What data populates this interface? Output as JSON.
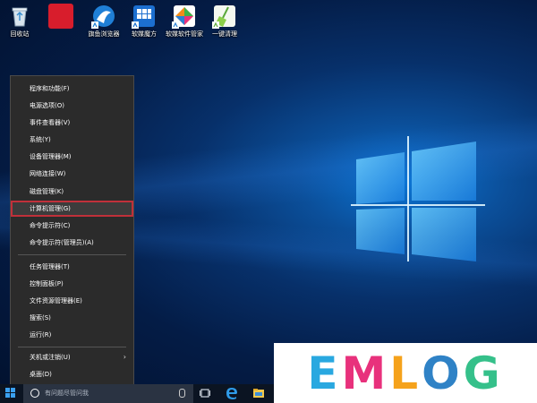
{
  "desktop": {
    "icons": [
      {
        "label": "回收站",
        "icon": "recycle-bin-icon"
      },
      {
        "label": "",
        "icon": "red-app-icon"
      },
      {
        "label": "旗鱼浏览器",
        "icon": "browser-icon"
      },
      {
        "label": "软媒魔方",
        "icon": "rubik-cube-icon"
      },
      {
        "label": "软媒软件管家",
        "icon": "software-manager-icon"
      },
      {
        "label": "一键清理",
        "icon": "broom-cleaner-icon"
      }
    ]
  },
  "context_menu": {
    "items": [
      {
        "label": "程序和功能(F)"
      },
      {
        "label": "电源选项(O)"
      },
      {
        "label": "事件查看器(V)"
      },
      {
        "label": "系统(Y)"
      },
      {
        "label": "设备管理器(M)"
      },
      {
        "label": "网络连接(W)"
      },
      {
        "label": "磁盘管理(K)"
      },
      {
        "label": "计算机管理(G)",
        "highlighted": true
      },
      {
        "label": "命令提示符(C)"
      },
      {
        "label": "命令提示符(管理员)(A)"
      },
      {
        "label": "任务管理器(T)"
      },
      {
        "label": "控制面板(P)"
      },
      {
        "label": "文件资源管理器(E)"
      },
      {
        "label": "搜索(S)"
      },
      {
        "label": "运行(R)"
      },
      {
        "label": "关机或注销(U)",
        "has_submenu": true
      },
      {
        "label": "桌面(D)"
      }
    ],
    "highlight_color": "#c0303a"
  },
  "taskbar": {
    "search_placeholder": "有问题尽管问我",
    "icons": [
      "start-icon",
      "search-icon",
      "microphone-icon",
      "task-view-icon",
      "edge-icon",
      "file-explorer-icon"
    ]
  },
  "watermark": {
    "letters": [
      {
        "char": "E",
        "color": "#29a8e0"
      },
      {
        "char": "M",
        "color": "#e8317c"
      },
      {
        "char": "L",
        "color": "#f5a21b"
      },
      {
        "char": "O",
        "color": "#2f82c6"
      },
      {
        "char": "G",
        "color": "#35c08a"
      }
    ]
  }
}
